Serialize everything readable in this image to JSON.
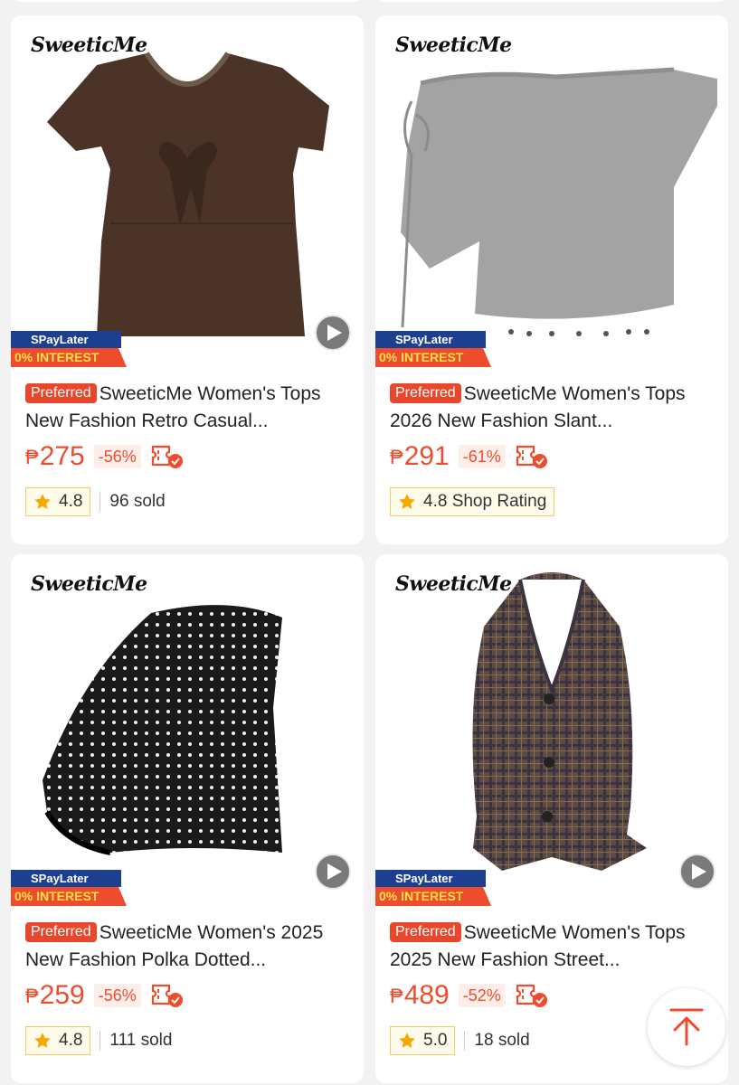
{
  "products": [
    {
      "brand": "SweeticMe",
      "spaylater": "SPayLater",
      "interest": "0% INTEREST",
      "preferred": "Preferred",
      "title": "SweeticMe Women's Tops New Fashion Retro Casual...",
      "currency": "₱",
      "price": "275",
      "discount": "-56%",
      "rating": "4.8",
      "sold": "96 sold"
    },
    {
      "brand": "SweeticMe",
      "spaylater": "SPayLater",
      "interest": "0% INTEREST",
      "preferred": "Preferred",
      "title": "SweeticMe Women's Tops 2026 New Fashion Slant...",
      "currency": "₱",
      "price": "291",
      "discount": "-61%",
      "rating": "4.8 Shop Rating",
      "sold": ""
    },
    {
      "brand": "SweeticMe",
      "spaylater": "SPayLater",
      "interest": "0% INTEREST",
      "preferred": "Preferred",
      "title": "SweeticMe Women's 2025 New Fashion Polka Dotted...",
      "currency": "₱",
      "price": "259",
      "discount": "-56%",
      "rating": "4.8",
      "sold": "111 sold"
    },
    {
      "brand": "SweeticMe",
      "spaylater": "SPayLater",
      "interest": "0% INTEREST",
      "preferred": "Preferred",
      "title": "SweeticMe Women's Tops 2025 New Fashion Street...",
      "currency": "₱",
      "price": "489",
      "discount": "-52%",
      "rating": "5.0",
      "sold": "18 sold"
    }
  ],
  "colors": {
    "accent": "#ee4d2d",
    "spay_blue": "#1d3f8f",
    "star": "#f6a700"
  },
  "icons": {
    "play": "play-icon",
    "voucher": "voucher-icon",
    "star": "star-icon",
    "back_to_top": "arrow-up-icon"
  }
}
